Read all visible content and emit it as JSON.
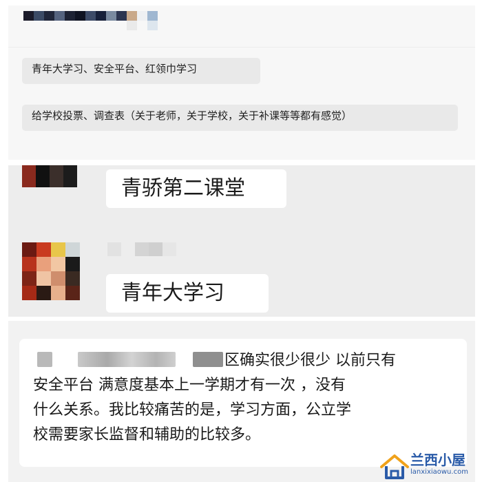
{
  "panel1": {
    "chips": [
      {
        "text": "青年大学习、安全平台、红领巾学习"
      },
      {
        "text": "给学校投票、调查表（关于老师，关于学校，关于补课等等都有感觉）"
      }
    ]
  },
  "panel2": {
    "messages": [
      {
        "text": "青骄第二课堂"
      },
      {
        "text": "青年大学习"
      }
    ]
  },
  "panel3": {
    "message_lines": [
      "区确实很少很少 以前只有",
      "安全平台 满意度基本上一学期才有一次 ，没有",
      "什么关系。我比较痛苦的是，学习方面，公立学",
      "校需要家长监督和辅助的比较多。"
    ]
  },
  "watermark": {
    "title": "兰西小屋",
    "subtitle": "lanxixiaowu.com"
  }
}
